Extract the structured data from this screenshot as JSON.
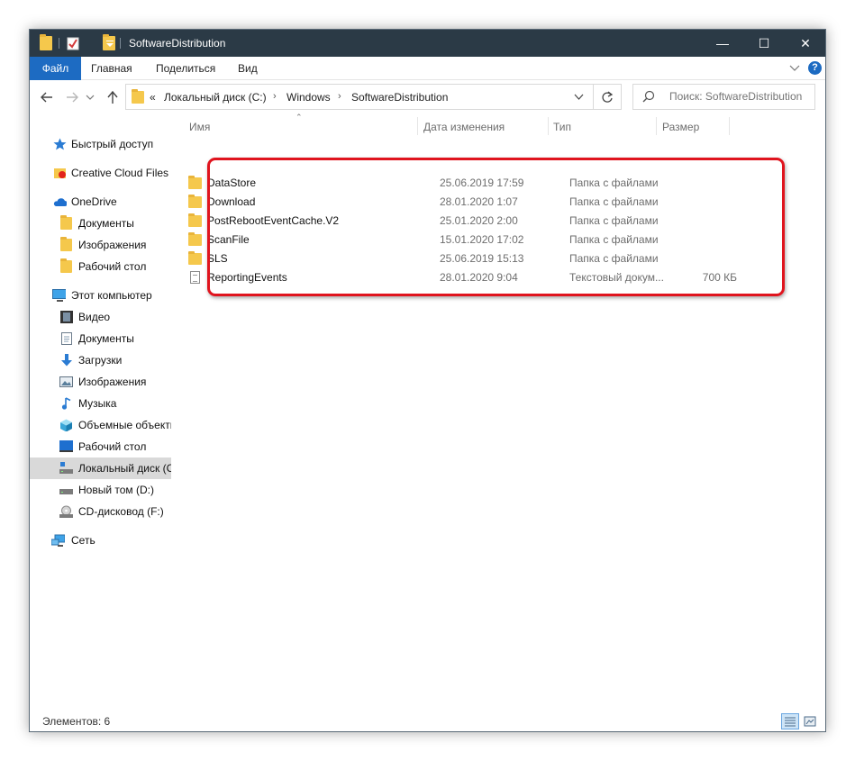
{
  "window": {
    "title": "SoftwareDistribution",
    "controls": {
      "minimize": "—",
      "maximize": "☐",
      "close": "✕"
    }
  },
  "ribbon": {
    "tabs": [
      "Файл",
      "Главная",
      "Поделиться",
      "Вид"
    ],
    "help": "?"
  },
  "address": {
    "overflow": "«",
    "crumbs": [
      "Локальный диск (C:)",
      "Windows",
      "SoftwareDistribution"
    ]
  },
  "search": {
    "placeholder": "Поиск: SoftwareDistribution"
  },
  "sidebar": {
    "items": [
      {
        "label": "Быстрый доступ",
        "icon": "star-icon"
      },
      {
        "label": "Creative Cloud Files",
        "icon": "creative-cloud-icon"
      },
      {
        "label": "OneDrive",
        "icon": "cloud-icon"
      },
      {
        "label": "Документы",
        "icon": "folder-icon"
      },
      {
        "label": "Изображения",
        "icon": "folder-icon"
      },
      {
        "label": "Рабочий стол",
        "icon": "folder-icon"
      },
      {
        "label": "Этот компьютер",
        "icon": "computer-icon"
      },
      {
        "label": "Видео",
        "icon": "video-icon"
      },
      {
        "label": "Документы",
        "icon": "documents-icon"
      },
      {
        "label": "Загрузки",
        "icon": "download-icon"
      },
      {
        "label": "Изображения",
        "icon": "pictures-icon"
      },
      {
        "label": "Музыка",
        "icon": "music-icon"
      },
      {
        "label": "Объемные объекты",
        "icon": "3d-objects-icon"
      },
      {
        "label": "Рабочий стол",
        "icon": "desktop-icon"
      },
      {
        "label": "Локальный диск (C:)",
        "icon": "drive-c-icon"
      },
      {
        "label": "Новый том (D:)",
        "icon": "drive-icon"
      },
      {
        "label": "CD-дисковод (F:)",
        "icon": "cd-drive-icon"
      },
      {
        "label": "Сеть",
        "icon": "network-icon"
      }
    ]
  },
  "columns": {
    "name": "Имя",
    "date": "Дата изменения",
    "type": "Тип",
    "size": "Размер"
  },
  "files": [
    {
      "name": "DataStore",
      "date": "25.06.2019 17:59",
      "type": "Папка с файлами",
      "size": "",
      "kind": "folder"
    },
    {
      "name": "Download",
      "date": "28.01.2020 1:07",
      "type": "Папка с файлами",
      "size": "",
      "kind": "folder"
    },
    {
      "name": "PostRebootEventCache.V2",
      "date": "25.01.2020 2:00",
      "type": "Папка с файлами",
      "size": "",
      "kind": "folder"
    },
    {
      "name": "ScanFile",
      "date": "15.01.2020 17:02",
      "type": "Папка с файлами",
      "size": "",
      "kind": "folder"
    },
    {
      "name": "SLS",
      "date": "25.06.2019 15:13",
      "type": "Папка с файлами",
      "size": "",
      "kind": "folder"
    },
    {
      "name": "ReportingEvents",
      "date": "28.01.2020 9:04",
      "type": "Текстовый докум...",
      "size": "700 КБ",
      "kind": "text-file"
    }
  ],
  "status": {
    "item_count": "Элементов: 6"
  },
  "colors": {
    "titlebar": "#2b3a46",
    "accent": "#1d6bc2",
    "highlight": "#e0141e",
    "folder": "#f5c84c"
  }
}
